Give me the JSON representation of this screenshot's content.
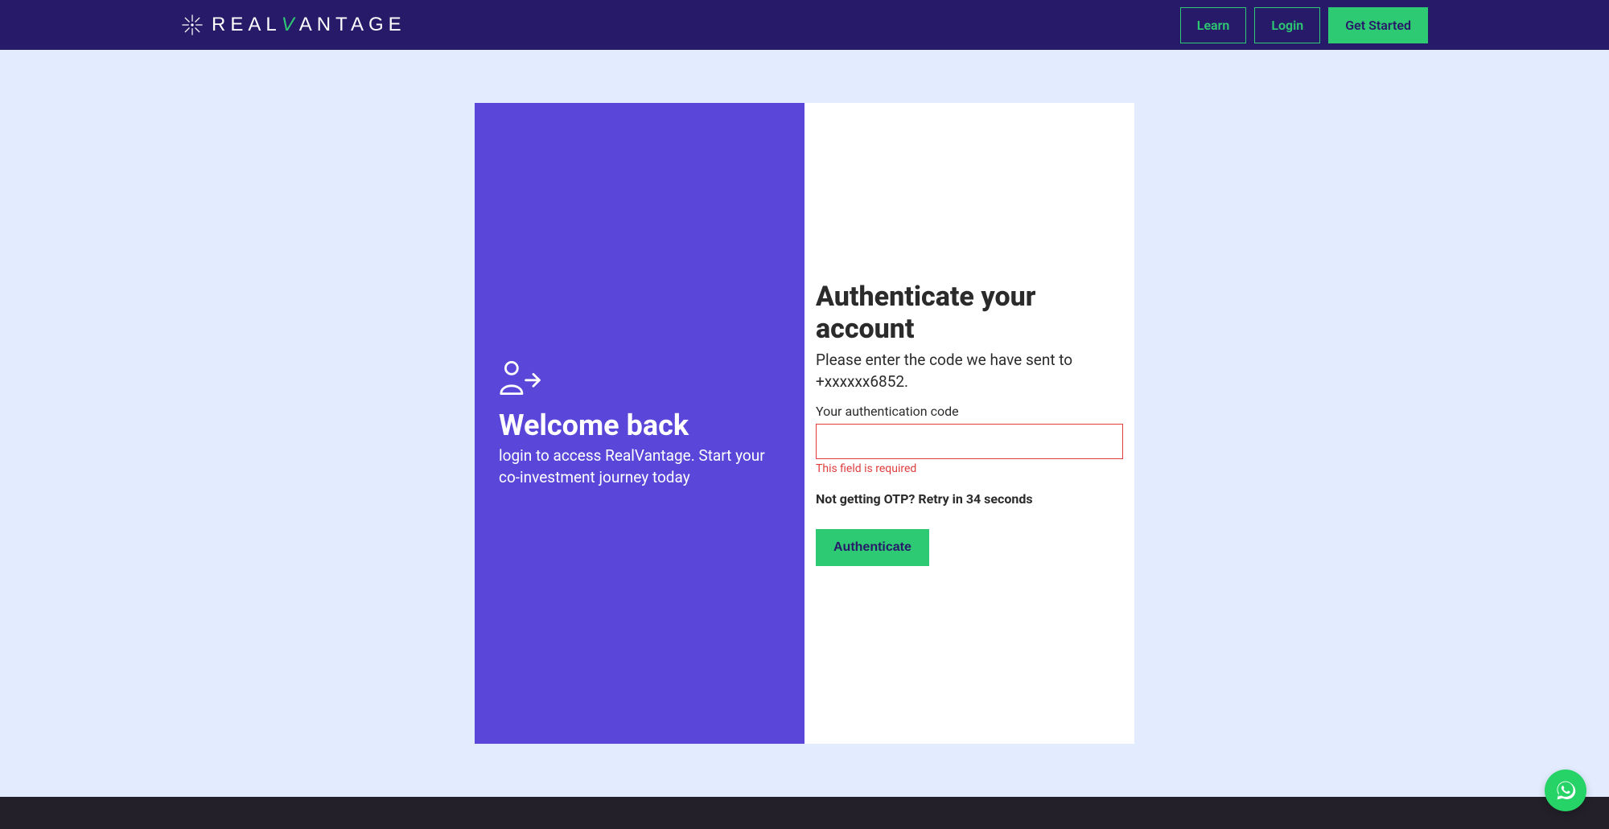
{
  "header": {
    "brand": "REALVANTAGE",
    "nav": {
      "learn": "Learn",
      "login": "Login",
      "get_started": "Get Started"
    }
  },
  "left_panel": {
    "title": "Welcome back",
    "subtitle": "login to access RealVantage. Start your co-investment journey today"
  },
  "right_panel": {
    "title": "Authenticate your account",
    "subtext": "Please enter the code we have sent to +xxxxxx6852.",
    "field_label": "Your authentication code",
    "code_value": "",
    "error": "This field is required",
    "retry": "Not getting OTP? Retry in 34 seconds",
    "button": "Authenticate"
  }
}
